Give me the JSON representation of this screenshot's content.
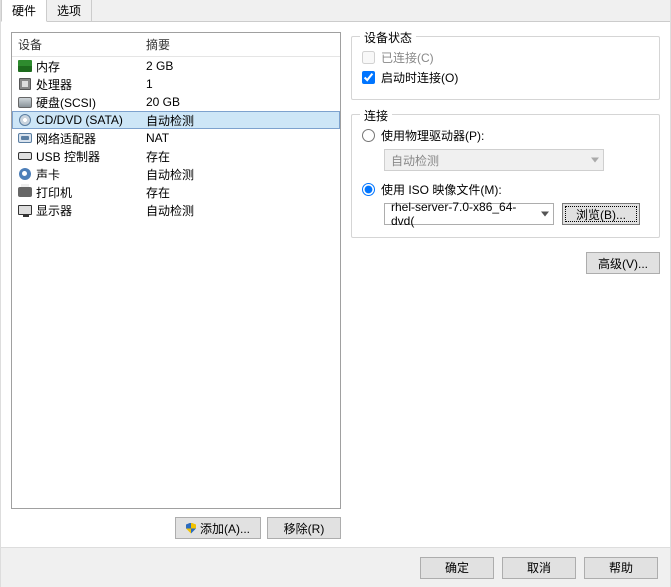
{
  "tabs": {
    "hardware": "硬件",
    "options": "选项"
  },
  "headers": {
    "device": "设备",
    "summary": "摘要"
  },
  "hardware": [
    {
      "label": "内存",
      "summary": "2 GB"
    },
    {
      "label": "处理器",
      "summary": "1"
    },
    {
      "label": "硬盘(SCSI)",
      "summary": "20 GB"
    },
    {
      "label": "CD/DVD (SATA)",
      "summary": "自动检测"
    },
    {
      "label": "网络适配器",
      "summary": "NAT"
    },
    {
      "label": "USB 控制器",
      "summary": "存在"
    },
    {
      "label": "声卡",
      "summary": "自动检测"
    },
    {
      "label": "打印机",
      "summary": "存在"
    },
    {
      "label": "显示器",
      "summary": "自动检测"
    }
  ],
  "buttons": {
    "add": "添加(A)...",
    "remove": "移除(R)",
    "browse": "浏览(B)...",
    "advanced": "高级(V)...",
    "ok": "确定",
    "cancel": "取消",
    "help": "帮助"
  },
  "status": {
    "title": "设备状态",
    "connected": "已连接(C)",
    "connectAtPowerOn": "启动时连接(O)"
  },
  "connection": {
    "title": "连接",
    "physical": "使用物理驱动器(P):",
    "physicalValue": "自动检测",
    "iso": "使用 ISO 映像文件(M):",
    "isoValue": "rhel-server-7.0-x86_64-dvd("
  }
}
